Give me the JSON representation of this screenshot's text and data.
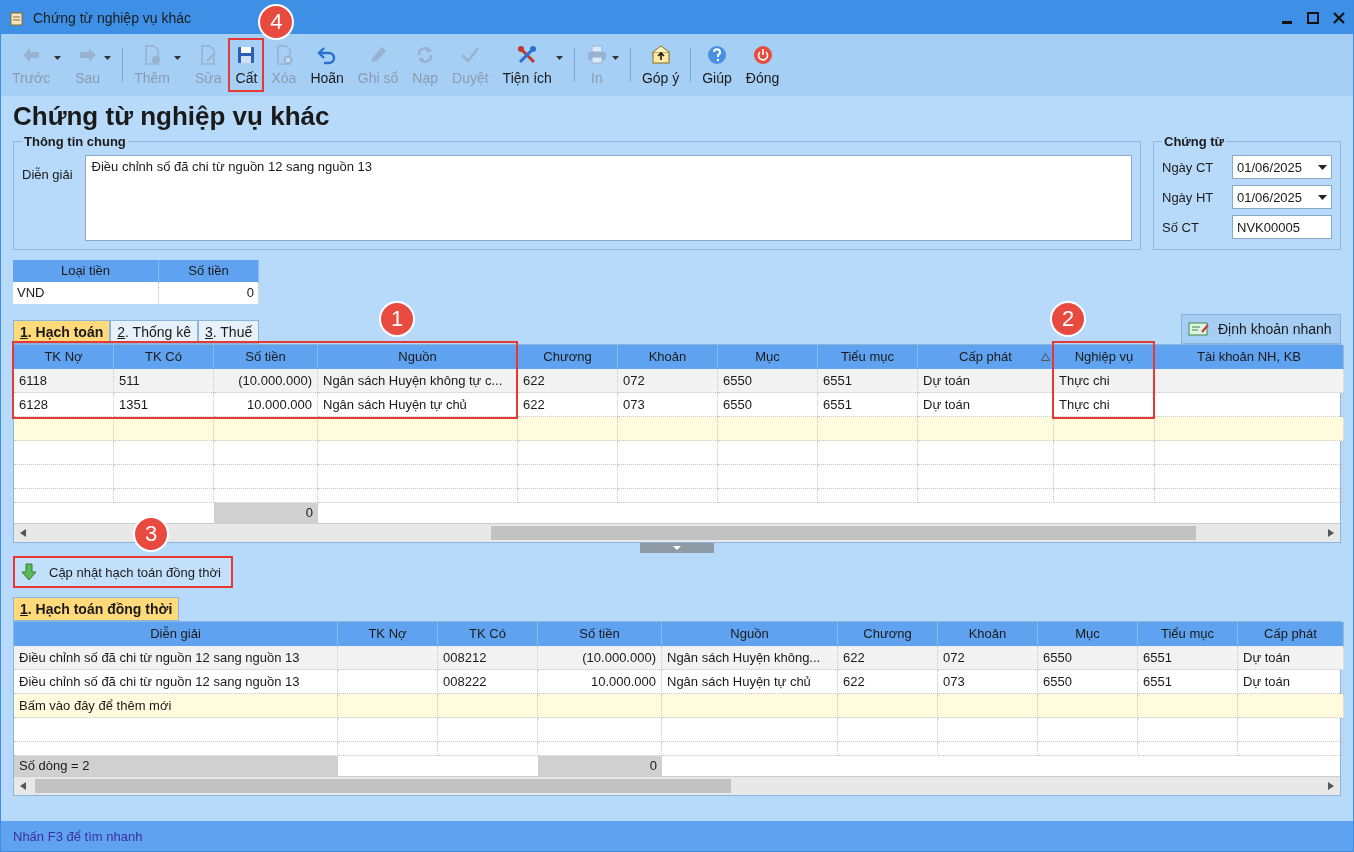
{
  "window": {
    "title": "Chứng từ nghiệp vụ khác"
  },
  "toolbar": [
    {
      "kind": "button",
      "label": "Trước",
      "disabled": true,
      "dropdown": true
    },
    {
      "kind": "button",
      "label": "Sau",
      "disabled": true,
      "dropdown": true
    },
    {
      "kind": "separator"
    },
    {
      "kind": "button",
      "label": "Thêm",
      "disabled": true,
      "dropdown": true
    },
    {
      "kind": "button",
      "label": "Sửa",
      "disabled": true,
      "dropdown": false
    },
    {
      "kind": "button",
      "label": "Cất",
      "disabled": false,
      "dropdown": false,
      "highlighted": true,
      "callout": "4"
    },
    {
      "kind": "button",
      "label": "Xóa",
      "disabled": true,
      "dropdown": false
    },
    {
      "kind": "button",
      "label": "Hoãn",
      "disabled": false,
      "dropdown": false
    },
    {
      "kind": "button",
      "label": "Ghi sổ",
      "disabled": true,
      "dropdown": false
    },
    {
      "kind": "button",
      "label": "Nạp",
      "disabled": true,
      "dropdown": false
    },
    {
      "kind": "button",
      "label": "Duyệt",
      "disabled": true,
      "dropdown": false
    },
    {
      "kind": "button",
      "label": "Tiện ích",
      "disabled": false,
      "dropdown": true
    },
    {
      "kind": "separator"
    },
    {
      "kind": "button",
      "label": "In",
      "disabled": true,
      "dropdown": true
    },
    {
      "kind": "separator"
    },
    {
      "kind": "button",
      "label": "Góp ý",
      "disabled": false,
      "dropdown": false
    },
    {
      "kind": "separator"
    },
    {
      "kind": "button",
      "label": "Giúp",
      "disabled": false,
      "dropdown": false
    },
    {
      "kind": "button",
      "label": "Đóng",
      "disabled": false,
      "dropdown": false
    }
  ],
  "heading": "Chứng từ nghiệp vụ khác",
  "general_info": {
    "legend": "Thông tin chung",
    "description_label": "Diễn giải",
    "description": "Điều chỉnh số đã chi từ nguồn 12 sang nguồn 13"
  },
  "voucher": {
    "legend": "Chứng từ",
    "fields": [
      {
        "kind": "date",
        "label": "Ngày CT",
        "value": "01/06/2025"
      },
      {
        "kind": "date",
        "label": "Ngày HT",
        "value": "01/06/2025"
      },
      {
        "kind": "text",
        "label": "Số CT",
        "value": "NVK00005"
      }
    ]
  },
  "currency": {
    "columns": [
      "Loại tiền",
      "Số tiền"
    ],
    "row": [
      "VND",
      "0"
    ]
  },
  "tabs": [
    {
      "label": "1. Hạch toán",
      "selected": true
    },
    {
      "label": "2. Thống kê",
      "selected": false
    },
    {
      "label": "3. Thuế",
      "selected": false
    }
  ],
  "quick_entry_button": "Định khoản nhanh",
  "grid": {
    "columns": [
      {
        "label": "TK Nợ",
        "kind": "text",
        "highlighted": true
      },
      {
        "label": "TK Có",
        "kind": "text",
        "highlighted": true
      },
      {
        "label": "Số tiền",
        "kind": "amount",
        "highlighted": true
      },
      {
        "label": "Nguồn",
        "kind": "text",
        "highlighted": true,
        "callout": "1"
      },
      {
        "label": "Chương",
        "kind": "text"
      },
      {
        "label": "Khoản",
        "kind": "text"
      },
      {
        "label": "Mục",
        "kind": "text"
      },
      {
        "label": "Tiểu mục",
        "kind": "text"
      },
      {
        "label": "Cấp phát",
        "kind": "text",
        "sorted": true
      },
      {
        "label": "Nghiệp vụ",
        "kind": "text",
        "highlighted": true,
        "callout": "2"
      },
      {
        "label": "Tài khoản NH, KB",
        "kind": "text"
      }
    ],
    "rows": [
      [
        "6118",
        "511",
        "(10.000.000)",
        "Ngân sách Huyện không tự c...",
        "622",
        "072",
        "6550",
        "6551",
        "Dự toán",
        "Thực chi",
        null
      ],
      [
        "6128",
        "1351",
        "10.000.000",
        "Ngân sách Huyện tự chủ",
        "622",
        "073",
        "6550",
        "6551",
        "Dự toán",
        "Thực chi",
        null
      ]
    ],
    "total": "0"
  },
  "update_button": {
    "label": "Cập nhật hạch toán đồng thời",
    "highlighted": true,
    "callout": "3"
  },
  "tabs_2": [
    {
      "label": "1. Hạch toán đồng thời",
      "selected": true
    }
  ],
  "grid_2": {
    "columns": [
      {
        "label": "Diễn giải",
        "kind": "text"
      },
      {
        "label": "TK Nợ",
        "kind": "text"
      },
      {
        "label": "TK Có",
        "kind": "text"
      },
      {
        "label": "Số tiền",
        "kind": "amount"
      },
      {
        "label": "Nguồn",
        "kind": "text"
      },
      {
        "label": "Chương",
        "kind": "text"
      },
      {
        "label": "Khoản",
        "kind": "text"
      },
      {
        "label": "Mục",
        "kind": "text"
      },
      {
        "label": "Tiểu mục",
        "kind": "text"
      },
      {
        "label": "Cấp phát",
        "kind": "text"
      }
    ],
    "rows": [
      [
        "Điều chỉnh số đã chi từ nguồn 12 sang nguồn 13",
        null,
        "008212",
        "(10.000.000)",
        "Ngân sách Huyện không...",
        "622",
        "072",
        "6550",
        "6551",
        "Dự toán"
      ],
      [
        "Điều chỉnh số đã chi từ nguồn 12 sang nguồn 13",
        null,
        "008222",
        "10.000.000",
        "Ngân sách Huyện tự chủ",
        "622",
        "073",
        "6550",
        "6551",
        "Dự toán"
      ]
    ],
    "new_row_hint": "Bấm vào đây để thêm mới",
    "row_count": "Số dòng = 2",
    "total": "0"
  },
  "status_bar": "Nhấn F3 để tìm nhanh"
}
